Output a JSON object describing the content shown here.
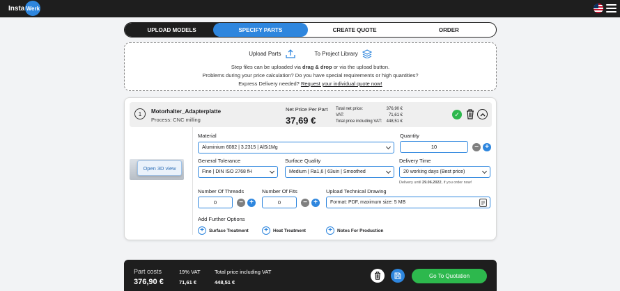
{
  "header": {
    "logo_text1": "Insta",
    "logo_text2": "Werk"
  },
  "steps": [
    "UPLOAD MODELS",
    "SPECIFY PARTS",
    "CREATE QUOTE",
    "ORDER"
  ],
  "upload": {
    "upload_parts": "Upload Parts",
    "to_library": "To Project Library",
    "line1_a": "Step files can be uploaded via ",
    "line1_b": "drag & drop",
    "line1_c": " or via the upload button.",
    "line2": "Problems during your price calculation? Do you have special requirements or high quantities?",
    "line3_a": "Express Delivery needed? ",
    "line3_link": "Request your individual quote now!"
  },
  "part": {
    "number": "1",
    "name": "Motorhalter_Adapterplatte",
    "process": "Process: CNC milling",
    "net_label": "Net Price Per Part",
    "net_value": "37,69 €",
    "totals": [
      {
        "label": "Total net price:",
        "value": "376,90 €"
      },
      {
        "label": "VAT:",
        "value": "71,61 €"
      },
      {
        "label": "Total price including VAT:",
        "value": "448,51 €"
      }
    ],
    "open_3d": "Open 3D view",
    "material_label": "Material",
    "material_value": "Aluminium 6082 | 3.2315 | AlSi1Mg",
    "quantity_label": "Quantity",
    "quantity_value": "10",
    "tolerance_label": "General Tolerance",
    "tolerance_value": "Fine | DIN ISO 2768 fH",
    "surface_label": "Surface Quality",
    "surface_value": "Medium | Ra1,6 | 63uin | Smoothed",
    "delivery_label": "Delivery Time",
    "delivery_value": "20 working days (Best price)",
    "delivery_note_a": "Delivery until ",
    "delivery_note_date": "29.06.2022",
    "delivery_note_b": ", if you order now!",
    "threads_label": "Number Of Threads",
    "threads_value": "0",
    "fits_label": "Number Of Fits",
    "fits_value": "0",
    "drawing_label": "Upload Technical Drawing",
    "drawing_placeholder": "Format: PDF, maximum size: 5 MB",
    "further_label": "Add Further Options",
    "options": [
      "Surface Treatment",
      "Heat Treatment",
      "Notes For Production"
    ]
  },
  "summary": {
    "part_costs_label": "Part costs",
    "part_costs_value": "376,90 €",
    "vat_label": "19% VAT",
    "vat_value": "71,61 €",
    "total_label": "Total price including VAT",
    "total_value": "448,51 €",
    "go_button": "Go To Quotation"
  },
  "colors": {
    "accent": "#2e86de",
    "dark": "#1e1e1e",
    "success": "#2db84d"
  }
}
